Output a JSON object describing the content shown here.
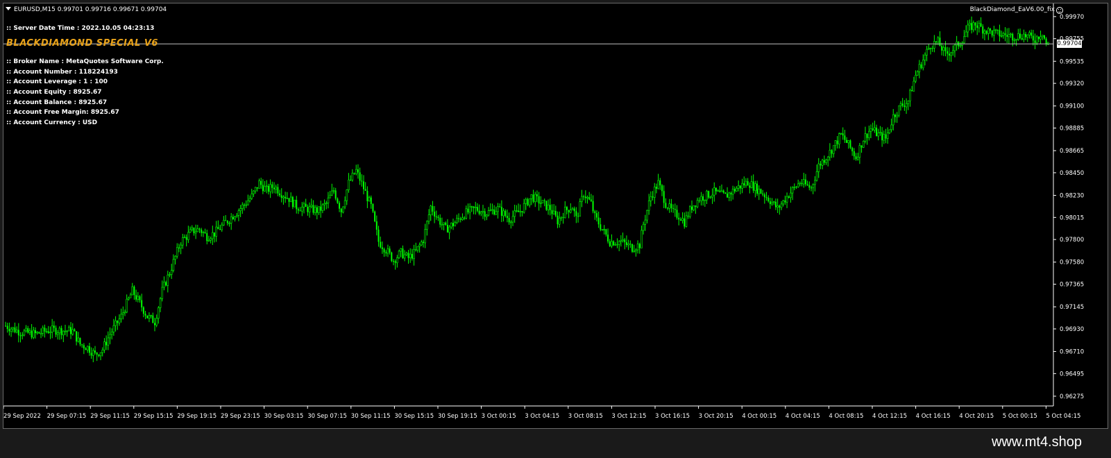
{
  "window": {
    "symbol_text": "EURUSD,M15  0.99701 0.99716 0.99671 0.99704",
    "expert_label": "BlackDiamond_EaV6.00_fix",
    "smiley_icon": "smiley-face-icon"
  },
  "panel": {
    "server_time": ":: Server Date Time : 2022.10.05 04:23:13",
    "title": "BLACKDIAMOND SPECIAL V6",
    "title_color": "#e8a21a",
    "lines": [
      ":: Broker Name : MetaQuotes Software Corp.",
      ":: Account Number : 118224193",
      ":: Account Leverage : 1 : 100",
      ":: Account Equity : 8925.67",
      ":: Account Balance : 8925.67",
      ":: Account Free Margin: 8925.67",
      ":: Account Currency : USD"
    ]
  },
  "price_tag": "0.99704",
  "footer": {
    "watermark": "www.mt4.shop"
  },
  "chart_data": {
    "type": "candlestick",
    "symbol": "EURUSD",
    "timeframe": "M15",
    "current_price": 0.99704,
    "bar_color": "#00ff00",
    "background": "#000000",
    "ylim": [
      0.9618,
      1.0003
    ],
    "y_ticks": [
      "0.99970",
      "0.99755",
      "0.99535",
      "0.99320",
      "0.99100",
      "0.98885",
      "0.98665",
      "0.98450",
      "0.98230",
      "0.98015",
      "0.97800",
      "0.97580",
      "0.97365",
      "0.97145",
      "0.96930",
      "0.96710",
      "0.96495",
      "0.96275"
    ],
    "x_ticks": [
      "29 Sep 2022",
      "29 Sep 07:15",
      "29 Sep 11:15",
      "29 Sep 15:15",
      "29 Sep 19:15",
      "29 Sep 23:15",
      "30 Sep 03:15",
      "30 Sep 07:15",
      "30 Sep 11:15",
      "30 Sep 15:15",
      "30 Sep 19:15",
      "3 Oct 00:15",
      "3 Oct 04:15",
      "3 Oct 08:15",
      "3 Oct 12:15",
      "3 Oct 16:15",
      "3 Oct 20:15",
      "4 Oct 00:15",
      "4 Oct 04:15",
      "4 Oct 08:15",
      "4 Oct 12:15",
      "4 Oct 16:15",
      "4 Oct 20:15",
      "5 Oct 00:15",
      "5 Oct 04:15"
    ],
    "price_path": [
      [
        0,
        0.9696
      ],
      [
        8,
        0.969
      ],
      [
        16,
        0.9688
      ],
      [
        24,
        0.9692
      ],
      [
        36,
        0.9691
      ],
      [
        40,
        0.9678
      ],
      [
        44,
        0.9675
      ],
      [
        48,
        0.9668
      ],
      [
        52,
        0.9673
      ],
      [
        56,
        0.9688
      ],
      [
        62,
        0.9705
      ],
      [
        68,
        0.973
      ],
      [
        72,
        0.9718
      ],
      [
        76,
        0.9705
      ],
      [
        80,
        0.97
      ],
      [
        84,
        0.973
      ],
      [
        88,
        0.9748
      ],
      [
        94,
        0.9778
      ],
      [
        100,
        0.9788
      ],
      [
        104,
        0.979
      ],
      [
        108,
        0.9783
      ],
      [
        112,
        0.9786
      ],
      [
        120,
        0.98
      ],
      [
        128,
        0.9814
      ],
      [
        132,
        0.9822
      ],
      [
        136,
        0.9835
      ],
      [
        140,
        0.9828
      ],
      [
        144,
        0.9832
      ],
      [
        148,
        0.9825
      ],
      [
        152,
        0.982
      ],
      [
        156,
        0.9812
      ],
      [
        162,
        0.981
      ],
      [
        168,
        0.9808
      ],
      [
        172,
        0.9815
      ],
      [
        176,
        0.9828
      ],
      [
        180,
        0.9808
      ],
      [
        184,
        0.9835
      ],
      [
        188,
        0.9847
      ],
      [
        192,
        0.983
      ],
      [
        196,
        0.9812
      ],
      [
        200,
        0.9778
      ],
      [
        204,
        0.977
      ],
      [
        208,
        0.976
      ],
      [
        212,
        0.9767
      ],
      [
        216,
        0.9762
      ],
      [
        220,
        0.9768
      ],
      [
        224,
        0.978
      ],
      [
        228,
        0.9812
      ],
      [
        232,
        0.98
      ],
      [
        236,
        0.979
      ],
      [
        240,
        0.9795
      ],
      [
        246,
        0.9805
      ],
      [
        252,
        0.981
      ],
      [
        258,
        0.9806
      ],
      [
        264,
        0.981
      ],
      [
        270,
        0.98
      ],
      [
        276,
        0.9808
      ],
      [
        282,
        0.9822
      ],
      [
        288,
        0.9815
      ],
      [
        292,
        0.981
      ],
      [
        296,
        0.9798
      ],
      [
        300,
        0.9808
      ],
      [
        304,
        0.9812
      ],
      [
        306,
        0.98
      ],
      [
        310,
        0.9825
      ],
      [
        314,
        0.9815
      ],
      [
        316,
        0.9802
      ],
      [
        320,
        0.979
      ],
      [
        324,
        0.9778
      ],
      [
        330,
        0.9778
      ],
      [
        336,
        0.9772
      ],
      [
        340,
        0.9775
      ],
      [
        342,
        0.9795
      ],
      [
        346,
        0.9822
      ],
      [
        350,
        0.9835
      ],
      [
        354,
        0.9815
      ],
      [
        358,
        0.9806
      ],
      [
        362,
        0.9802
      ],
      [
        364,
        0.9797
      ],
      [
        368,
        0.9812
      ],
      [
        372,
        0.982
      ],
      [
        380,
        0.9826
      ],
      [
        386,
        0.9822
      ],
      [
        392,
        0.983
      ],
      [
        398,
        0.9836
      ],
      [
        406,
        0.9825
      ],
      [
        410,
        0.9818
      ],
      [
        414,
        0.981
      ],
      [
        420,
        0.9824
      ],
      [
        426,
        0.9836
      ],
      [
        432,
        0.983
      ],
      [
        436,
        0.9852
      ],
      [
        442,
        0.9865
      ],
      [
        448,
        0.9882
      ],
      [
        452,
        0.9872
      ],
      [
        456,
        0.986
      ],
      [
        460,
        0.9878
      ],
      [
        464,
        0.9888
      ],
      [
        468,
        0.9882
      ],
      [
        472,
        0.9878
      ],
      [
        476,
        0.99
      ],
      [
        480,
        0.991
      ],
      [
        484,
        0.9915
      ],
      [
        488,
        0.994
      ],
      [
        492,
        0.9955
      ],
      [
        496,
        0.997
      ],
      [
        500,
        0.9972
      ],
      [
        504,
        0.996
      ],
      [
        508,
        0.9965
      ],
      [
        512,
        0.9972
      ],
      [
        516,
        0.9985
      ],
      [
        520,
        0.999
      ],
      [
        524,
        0.9985
      ],
      [
        528,
        0.9982
      ],
      [
        532,
        0.998
      ],
      [
        540,
        0.9978
      ],
      [
        546,
        0.9979
      ],
      [
        552,
        0.9975
      ],
      [
        556,
        0.9982
      ],
      [
        558,
        0.997
      ],
      [
        560,
        0.997
      ]
    ]
  }
}
